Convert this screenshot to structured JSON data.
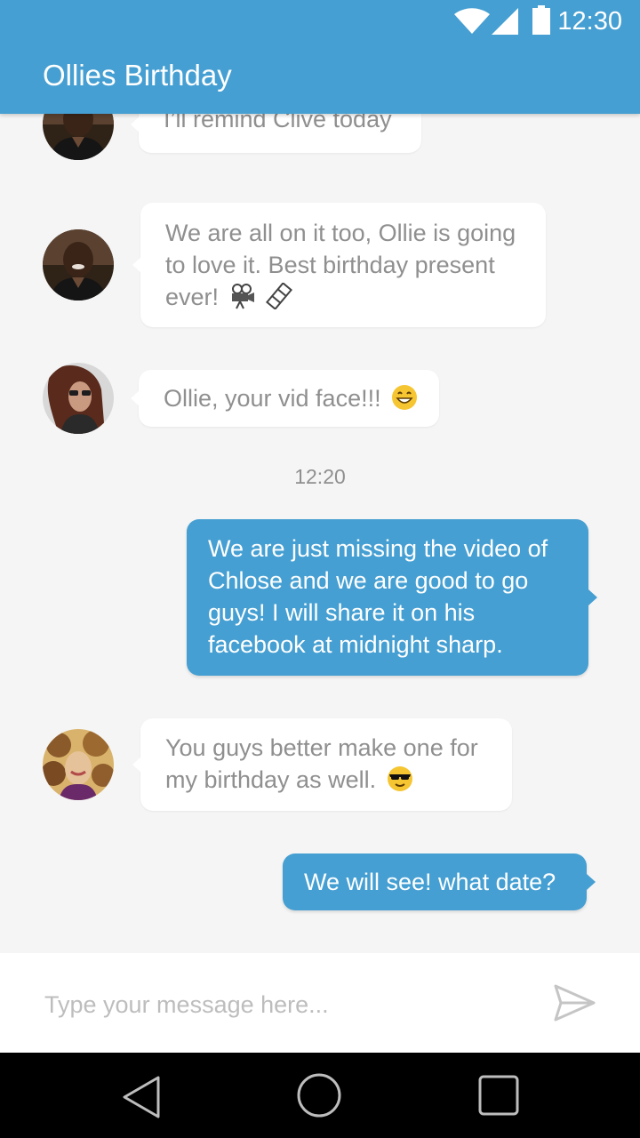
{
  "status_bar": {
    "time": "12:30",
    "icons": [
      "wifi-icon",
      "cellular-signal-icon",
      "battery-icon"
    ]
  },
  "app_bar": {
    "title": "Ollies Birthday"
  },
  "messages": [
    {
      "direction": "incoming",
      "avatar": "avatar-man",
      "text": "I’ll remind Clive today"
    },
    {
      "direction": "incoming",
      "avatar": "avatar-man",
      "line1": "We are all on it too, Ollie is going",
      "line2": "to love it. Best birthday present",
      "line3": "ever!",
      "emojis": [
        "movie-camera-emoji",
        "film-strip-emoji"
      ]
    },
    {
      "direction": "incoming",
      "avatar": "avatar-woman-sunglasses",
      "text": "Ollie, your vid face!!!",
      "emojis": [
        "grinning-face-emoji"
      ]
    },
    {
      "direction": "outgoing",
      "line1": "We are just missing the video of",
      "line2": "Chlose and we are good to go",
      "line3": "guys! I will share it on his",
      "line4": "facebook at midnight sharp."
    },
    {
      "direction": "incoming",
      "avatar": "avatar-woman-curly",
      "line1": "You guys better make one for",
      "line2": "my birthday as well.",
      "emojis": [
        "sunglasses-face-emoji"
      ]
    },
    {
      "direction": "outgoing",
      "text": "We will see! what date?"
    }
  ],
  "timestamp": "12:20",
  "composer": {
    "placeholder": "Type your message here...",
    "value": ""
  },
  "nav_bar": {
    "buttons": [
      "back-icon",
      "home-icon",
      "recents-icon"
    ]
  },
  "colors": {
    "accent": "#459fd2",
    "background": "#f5f5f5",
    "incoming_text": "#8f8f8f",
    "outgoing_text": "#ffffff"
  }
}
